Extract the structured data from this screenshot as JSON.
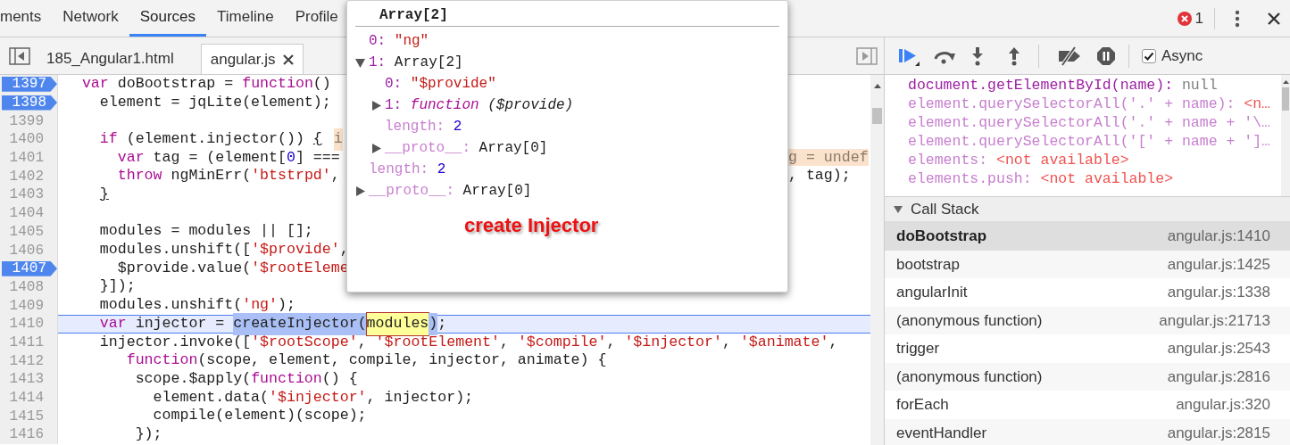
{
  "main_tabs": [
    {
      "label": "ments",
      "selected": false
    },
    {
      "label": "Network",
      "selected": false
    },
    {
      "label": "Sources",
      "selected": true
    },
    {
      "label": "Timeline",
      "selected": false
    },
    {
      "label": "Profile",
      "selected": false
    }
  ],
  "error_count": "1",
  "file_tabs": [
    {
      "label": "185_Angular1.html",
      "selected": false,
      "closable": false
    },
    {
      "label": "angular.js",
      "selected": true,
      "closable": true
    }
  ],
  "code_lines": [
    {
      "number": "1397",
      "breakpoint": true,
      "current": false,
      "tokens": [
        {
          "kind": "kw",
          "text": "  var"
        },
        {
          "kind": "pl",
          "text": " doBootstrap = "
        },
        {
          "kind": "kw",
          "text": "function"
        },
        {
          "kind": "pl",
          "text": "()"
        }
      ]
    },
    {
      "number": "1398",
      "breakpoint": true,
      "current": false,
      "tokens": [
        {
          "kind": "pl",
          "text": "    element = jqLite(element);"
        }
      ]
    },
    {
      "number": "1399",
      "breakpoint": false,
      "current": false
    },
    {
      "number": "1400",
      "breakpoint": false,
      "current": false,
      "tokens": [
        {
          "kind": "kw",
          "text": "    if"
        },
        {
          "kind": "pl",
          "text": " (element.injector()) "
        },
        {
          "kind": "ul",
          "text": "{"
        },
        {
          "kind": "hint",
          "text": "i"
        }
      ]
    },
    {
      "number": "1401",
      "breakpoint": false,
      "current": false,
      "tokens": [
        {
          "kind": "kw",
          "text": "      var"
        },
        {
          "kind": "pl",
          "text": " tag = (element["
        },
        {
          "kind": "num",
          "text": "0"
        },
        {
          "kind": "pl",
          "text": "] ==="
        }
      ],
      "tail": [
        {
          "kind": "hint",
          "text": "g = undef"
        }
      ]
    },
    {
      "number": "1402",
      "breakpoint": false,
      "current": false,
      "tokens": [
        {
          "kind": "kw",
          "text": "      throw"
        },
        {
          "kind": "pl",
          "text": " ngMinErr("
        },
        {
          "kind": "str",
          "text": "'btstrpd'"
        },
        {
          "kind": "pl",
          "text": ","
        }
      ],
      "tail": [
        {
          "kind": "pl",
          "text": ", tag);"
        }
      ]
    },
    {
      "number": "1403",
      "breakpoint": false,
      "current": false,
      "tokens": [
        {
          "kind": "ul",
          "text": "    }"
        }
      ]
    },
    {
      "number": "1404",
      "breakpoint": false,
      "current": false
    },
    {
      "number": "1405",
      "breakpoint": false,
      "current": false,
      "tokens": [
        {
          "kind": "pl",
          "text": "    modules = modules || [];"
        }
      ]
    },
    {
      "number": "1406",
      "breakpoint": false,
      "current": false,
      "tokens": [
        {
          "kind": "pl",
          "text": "    modules.unshift(["
        },
        {
          "kind": "str",
          "text": "'$provide'"
        },
        {
          "kind": "pl",
          "text": ","
        }
      ]
    },
    {
      "number": "1407",
      "breakpoint": true,
      "current": false,
      "tokens": [
        {
          "kind": "pl",
          "text": "      $provide.value("
        },
        {
          "kind": "str",
          "text": "'$rootEleme"
        }
      ]
    },
    {
      "number": "1408",
      "breakpoint": false,
      "current": false,
      "tokens": [
        {
          "kind": "pl",
          "text": "    }]);"
        }
      ]
    },
    {
      "number": "1409",
      "breakpoint": false,
      "current": false,
      "tokens": [
        {
          "kind": "pl",
          "text": "    modules.unshift("
        },
        {
          "kind": "str",
          "text": "'ng'"
        },
        {
          "kind": "pl",
          "text": ");"
        }
      ]
    },
    {
      "number": "1410",
      "breakpoint": false,
      "current": true,
      "tokens": [
        {
          "kind": "kw",
          "text": "    var"
        },
        {
          "kind": "pl",
          "text": " injector = "
        },
        {
          "kind": "sel",
          "text": "createInjector("
        },
        {
          "kind": "match",
          "text": "modules"
        },
        {
          "kind": "sel",
          "text": ")"
        },
        {
          "kind": "pl",
          "text": ";"
        }
      ]
    },
    {
      "number": "1411",
      "breakpoint": false,
      "current": false,
      "tokens": [
        {
          "kind": "pl",
          "text": "    injector.invoke(["
        },
        {
          "kind": "str",
          "text": "'$rootScope'"
        },
        {
          "kind": "pl",
          "text": ", "
        },
        {
          "kind": "str",
          "text": "'$rootElement'"
        },
        {
          "kind": "pl",
          "text": ", "
        },
        {
          "kind": "str",
          "text": "'$compile'"
        },
        {
          "kind": "pl",
          "text": ", "
        },
        {
          "kind": "str",
          "text": "'$injector'"
        },
        {
          "kind": "pl",
          "text": ", "
        },
        {
          "kind": "str",
          "text": "'$animate'"
        },
        {
          "kind": "pl",
          "text": ","
        }
      ]
    },
    {
      "number": "1412",
      "breakpoint": false,
      "current": false,
      "tokens": [
        {
          "kind": "kw",
          "text": "       function"
        },
        {
          "kind": "pl",
          "text": "(scope, element, compile, injector, animate) {"
        }
      ]
    },
    {
      "number": "1413",
      "breakpoint": false,
      "current": false,
      "tokens": [
        {
          "kind": "pl",
          "text": "        scope.$apply("
        },
        {
          "kind": "kw",
          "text": "function"
        },
        {
          "kind": "pl",
          "text": "() {"
        }
      ]
    },
    {
      "number": "1414",
      "breakpoint": false,
      "current": false,
      "tokens": [
        {
          "kind": "pl",
          "text": "          element.data("
        },
        {
          "kind": "str",
          "text": "'$injector'"
        },
        {
          "kind": "pl",
          "text": ", injector);"
        }
      ]
    },
    {
      "number": "1415",
      "breakpoint": false,
      "current": false,
      "tokens": [
        {
          "kind": "pl",
          "text": "          compile(element)(scope);"
        }
      ]
    },
    {
      "number": "1416",
      "breakpoint": false,
      "current": false,
      "tokens": [
        {
          "kind": "pl",
          "text": "        });"
        }
      ]
    }
  ],
  "popover": {
    "title": "Array[2]",
    "properties": [
      {
        "key": "0:",
        "value": "\"ng\"",
        "kind": "string",
        "dimmed": false
      },
      {
        "key": "1:",
        "value": "Array[2]",
        "kind": "object",
        "dimmed": false,
        "expanded": true,
        "children": [
          {
            "key": "0:",
            "value": "\"$provide\"",
            "kind": "string",
            "dimmed": false
          },
          {
            "key": "1:",
            "keyword": "function",
            "value": "($provide)",
            "kind": "function",
            "dimmed": false,
            "expanded": false
          },
          {
            "key": "length:",
            "value": "2",
            "kind": "number",
            "dimmed": true
          },
          {
            "key": "__proto__:",
            "value": "Array[0]",
            "kind": "object",
            "dimmed": true,
            "expanded": false
          }
        ]
      },
      {
        "key": "length:",
        "value": "2",
        "kind": "number",
        "dimmed": true
      },
      {
        "key": "__proto__:",
        "value": "Array[0]",
        "kind": "object",
        "dimmed": true,
        "expanded": false
      }
    ],
    "annotation": "create Injector"
  },
  "async": {
    "label": "Async",
    "checked": true
  },
  "watch": [
    {
      "expression": "document.getElementById(name):",
      "value": "null",
      "kind": "null",
      "dimmed": false
    },
    {
      "expression": "element.querySelectorAll('.' + name):",
      "value": "<n…",
      "kind": "error",
      "dimmed": true
    },
    {
      "expression": "element.querySelectorAll('.' + name + '\\…",
      "dimmed": true
    },
    {
      "expression": "element.querySelectorAll('[' + name + ']…",
      "dimmed": true
    },
    {
      "expression": "elements:",
      "value": "<not available>",
      "kind": "error",
      "dimmed": true
    },
    {
      "expression": "elements.push:",
      "value": "<not available>",
      "kind": "error",
      "dimmed": true
    }
  ],
  "call_stack": {
    "title": "Call Stack",
    "expanded": true,
    "frames": [
      {
        "function": "doBootstrap",
        "location": "angular.js:1410",
        "selected": true
      },
      {
        "function": "bootstrap",
        "location": "angular.js:1425",
        "selected": false
      },
      {
        "function": "angularInit",
        "location": "angular.js:1338",
        "selected": false
      },
      {
        "function": "(anonymous function)",
        "location": "angular.js:21713",
        "selected": false
      },
      {
        "function": "trigger",
        "location": "angular.js:2543",
        "selected": false
      },
      {
        "function": "(anonymous function)",
        "location": "angular.js:2816",
        "selected": false
      },
      {
        "function": "forEach",
        "location": "angular.js:320",
        "selected": false
      },
      {
        "function": "eventHandler",
        "location": "angular.js:2815",
        "selected": false
      }
    ]
  }
}
